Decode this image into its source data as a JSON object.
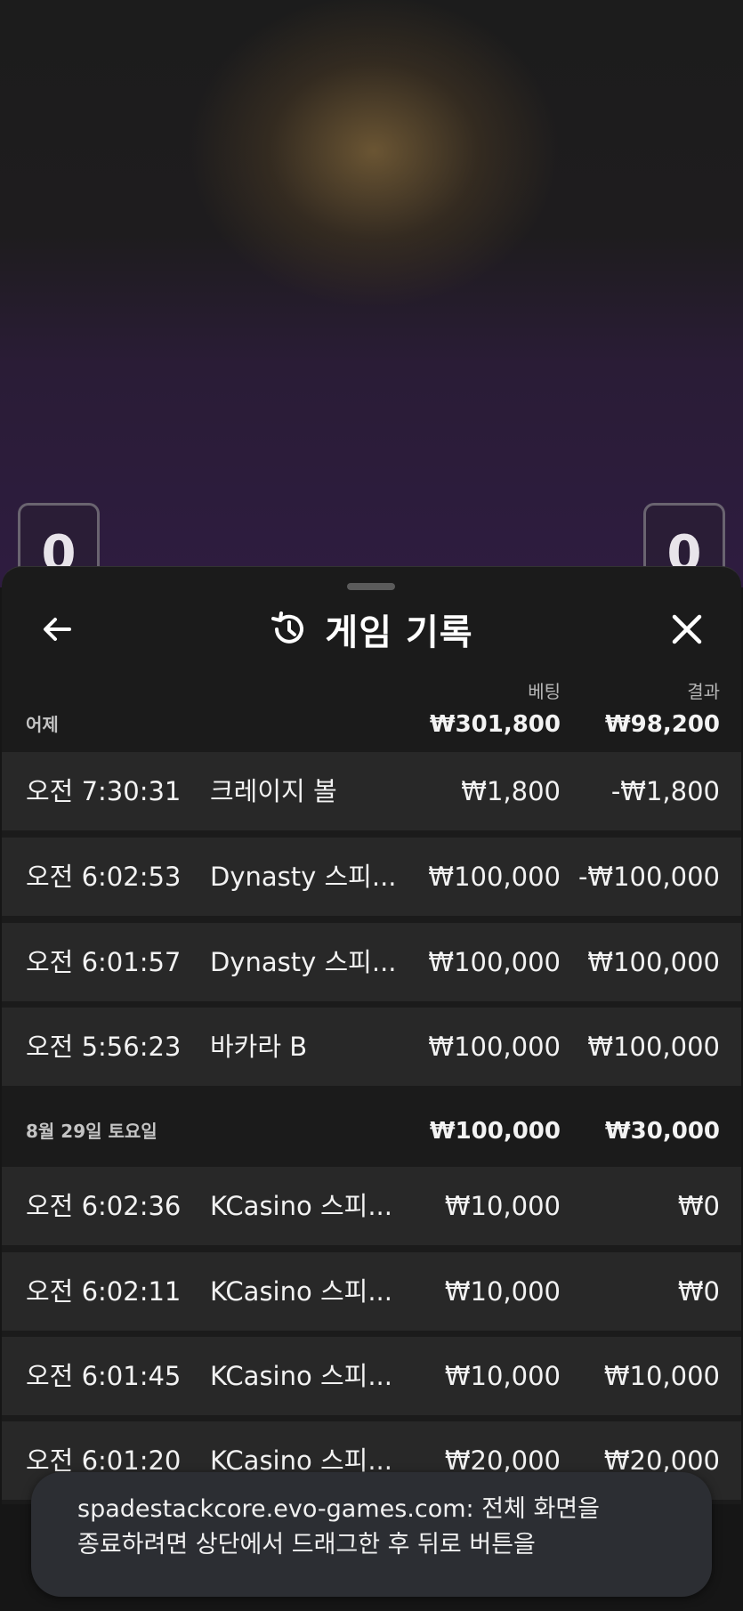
{
  "background": {
    "score_left": "0",
    "score_right": "0"
  },
  "header": {
    "title": "게임 기록",
    "back_icon": "arrow-left-icon",
    "history_icon": "history-icon",
    "close_icon": "close-icon"
  },
  "columns": {
    "bet": "베팅",
    "result": "결과"
  },
  "groups": [
    {
      "label": "어제",
      "bet_total": "₩301,800",
      "result_total": "₩98,200",
      "rows": [
        {
          "time": "오전 7:30:31",
          "game": "크레이지 볼",
          "bet": "₩1,800",
          "result": "-₩1,800"
        },
        {
          "time": "오전 6:02:53",
          "game": "Dynasty 스피...",
          "bet": "₩100,000",
          "result": "-₩100,000"
        },
        {
          "time": "오전 6:01:57",
          "game": "Dynasty 스피...",
          "bet": "₩100,000",
          "result": "₩100,000"
        },
        {
          "time": "오전 5:56:23",
          "game": "바카라 B",
          "bet": "₩100,000",
          "result": "₩100,000"
        }
      ]
    },
    {
      "label": "8월 29일 토요일",
      "bet_total": "₩100,000",
      "result_total": "₩30,000",
      "rows": [
        {
          "time": "오전 6:02:36",
          "game": "KCasino 스피...",
          "bet": "₩10,000",
          "result": "₩0"
        },
        {
          "time": "오전 6:02:11",
          "game": "KCasino 스피...",
          "bet": "₩10,000",
          "result": "₩0"
        },
        {
          "time": "오전 6:01:45",
          "game": "KCasino 스피...",
          "bet": "₩10,000",
          "result": "₩10,000"
        },
        {
          "time": "오전 6:01:20",
          "game": "KCasino 스피...",
          "bet": "₩20,000",
          "result": "₩20,000"
        }
      ]
    }
  ],
  "toast": {
    "line1": "spadestackcore.evo-games.com: 전체 화면을",
    "line2": "종료하려면 상단에서 드래그한 후 뒤로 버튼을"
  }
}
